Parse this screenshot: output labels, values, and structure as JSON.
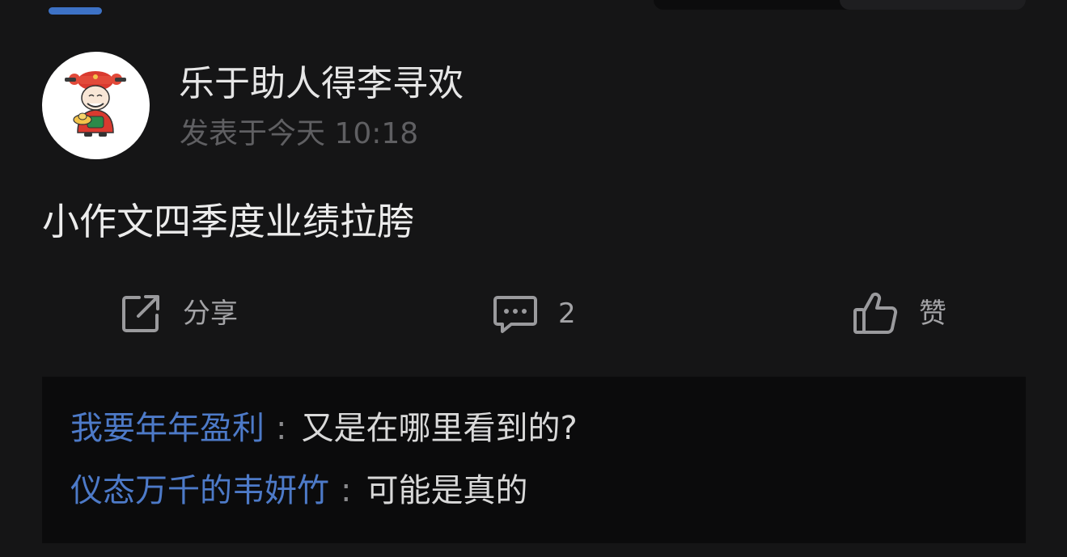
{
  "top": {
    "tab_indicator_color": "#3d72c6"
  },
  "post": {
    "author": {
      "name": "乐于助人得李寻欢",
      "avatar_icon": "god-of-wealth-avatar"
    },
    "timestamp": "发表于今天 10:18",
    "body": "小作文四季度业绩拉胯"
  },
  "actions": {
    "share": {
      "icon": "share-icon",
      "label": "分享"
    },
    "comment": {
      "icon": "comment-icon",
      "label": "2"
    },
    "like": {
      "icon": "thumbs-up-icon",
      "label": "赞"
    }
  },
  "comments": [
    {
      "author": "我要年年盈利",
      "separator": ":",
      "text": "又是在哪里看到的?"
    },
    {
      "author": "仪态万千的韦妍竹",
      "separator": ":",
      "text": "可能是真的"
    }
  ],
  "colors": {
    "background": "#151516",
    "link": "#4d7ac8",
    "comments_background": "#0b0b0c"
  }
}
